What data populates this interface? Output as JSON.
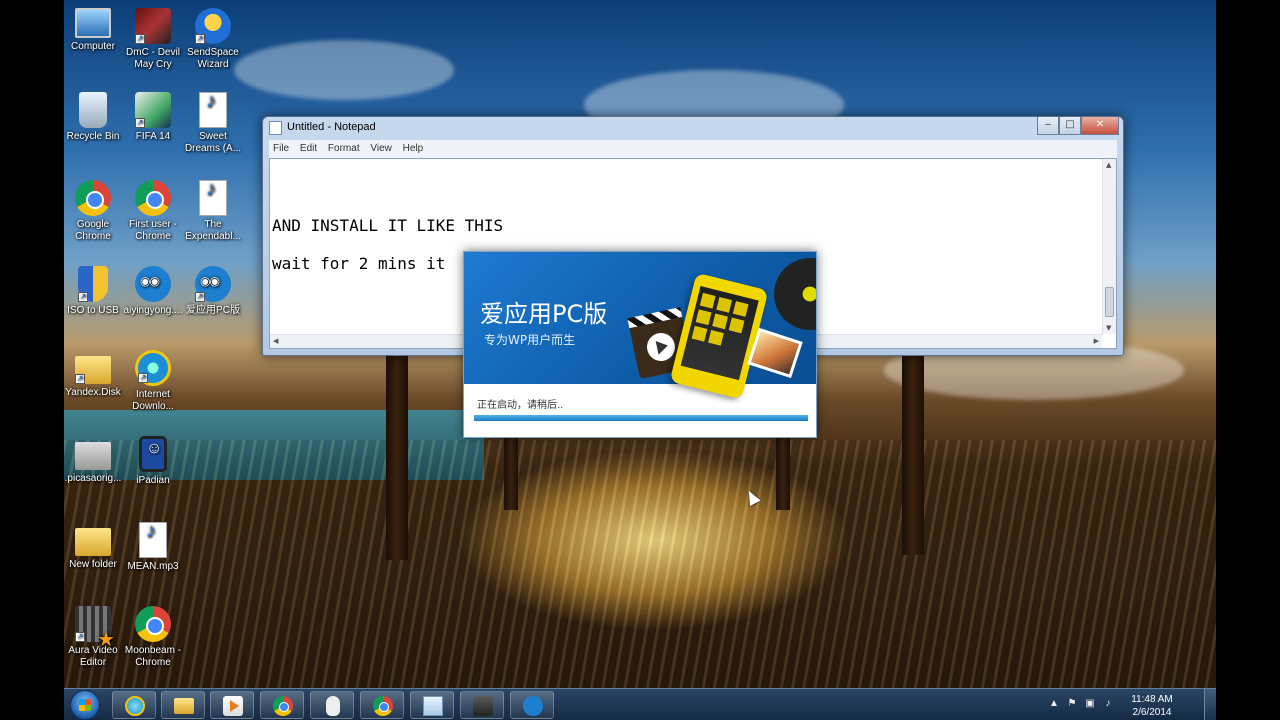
{
  "desktop_icons": [
    {
      "id": "computer",
      "label": "Computer",
      "icon": "computer-icon"
    },
    {
      "id": "dmc",
      "label": "DmC - Devil May Cry",
      "icon": "game-icon"
    },
    {
      "id": "sendspace",
      "label": "SendSpace Wizard",
      "icon": "sendspace-icon"
    },
    {
      "id": "recycle",
      "label": "Recycle Bin",
      "icon": "recycle-bin-icon"
    },
    {
      "id": "fifa",
      "label": "FIFA 14",
      "icon": "game-icon"
    },
    {
      "id": "sweet",
      "label": "Sweet Dreams (A...",
      "icon": "mp3-file-icon"
    },
    {
      "id": "chrome",
      "label": "Google Chrome",
      "icon": "chrome-icon"
    },
    {
      "id": "firstuser",
      "label": "First user - Chrome",
      "icon": "chrome-icon"
    },
    {
      "id": "expendables",
      "label": "The Expendabl...",
      "icon": "mp3-file-icon"
    },
    {
      "id": "isotousb",
      "label": "ISO to USB",
      "icon": "shield-icon"
    },
    {
      "id": "aiyingyong",
      "label": "aiyingyong....",
      "icon": "owl-icon"
    },
    {
      "id": "aiyingyong_pc",
      "label": "爱应用PC版",
      "icon": "owl-icon"
    },
    {
      "id": "yandex",
      "label": "Yandex.Disk",
      "icon": "folder-icon"
    },
    {
      "id": "ie",
      "label": "Internet Downlo...",
      "icon": "internet-download-icon"
    },
    {
      "id": "picasa",
      "label": ".picasaorig...",
      "icon": "folder-icon"
    },
    {
      "id": "ipadian",
      "label": "iPadian",
      "icon": "ipadian-icon"
    },
    {
      "id": "newfolder",
      "label": "New folder",
      "icon": "folder-icon"
    },
    {
      "id": "mean",
      "label": "MEAN.mp3",
      "icon": "mp3-file-icon"
    },
    {
      "id": "aura",
      "label": "Aura Video Editor",
      "icon": "video-editor-icon"
    },
    {
      "id": "moonbeam",
      "label": "Moonbeam - Chrome",
      "icon": "chrome-icon"
    }
  ],
  "notepad": {
    "title": "Untitled - Notepad",
    "menu": [
      "File",
      "Edit",
      "Format",
      "View",
      "Help"
    ],
    "lines": [
      "AND INSTALL IT LIKE THIS",
      "wait for 2 mins it"
    ],
    "controls": {
      "minimize": "‒",
      "maximize": "□",
      "close": "✕"
    }
  },
  "splash": {
    "title": "爱应用PC版",
    "subtitle": "专为WP用户而生",
    "status": "正在启动，请稍后..",
    "progress": 1.0
  },
  "taskbar": {
    "apps": [
      "internet-explorer",
      "windows-explorer",
      "media-player",
      "chrome",
      "mouse-utility",
      "chrome",
      "notepad",
      "media-app",
      "owl-app"
    ],
    "clock": {
      "time": "11:48 AM",
      "date": "2/6/2014"
    },
    "tray_icons": [
      "show-hidden-icon",
      "flag-icon",
      "network-icon",
      "volume-icon"
    ]
  },
  "colors": {
    "taskbar": "#1a3352",
    "splash_banner": "#1f7ad1",
    "progress_fill": "#1a7dc2"
  }
}
